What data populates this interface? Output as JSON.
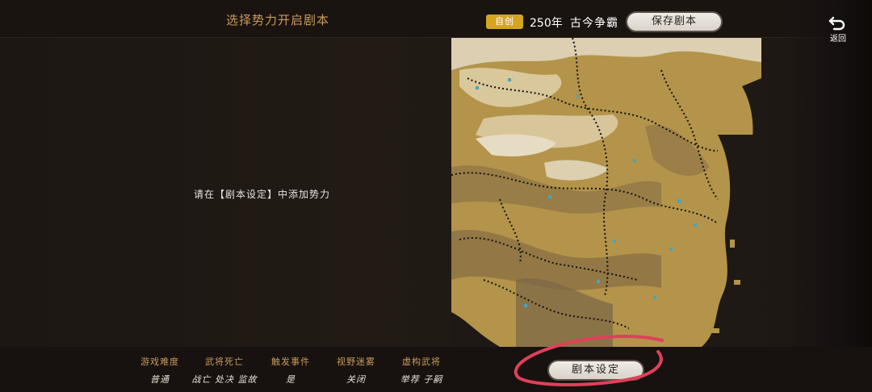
{
  "header": {
    "title": "选择势力开启剧本",
    "mode_badge": "自创",
    "year": "250年",
    "scenario_name": "古今争霸",
    "save_label": "保存剧本",
    "back_label": "返回"
  },
  "main": {
    "hint": "请在【剧本设定】中添加势力"
  },
  "settings": [
    {
      "label": "游戏难度",
      "value": "普通"
    },
    {
      "label": "武将死亡",
      "value": "战亡 处决 监故"
    },
    {
      "label": "触发事件",
      "value": "是"
    },
    {
      "label": "视野迷雾",
      "value": "关闭"
    },
    {
      "label": "虚构武将",
      "value": "举荐 子嗣"
    }
  ],
  "footer": {
    "scenario_settings_label": "剧本设定"
  },
  "colors": {
    "accent_gold": "#c99a5c",
    "badge": "#d5a521",
    "annotation_red": "#e0405a"
  }
}
